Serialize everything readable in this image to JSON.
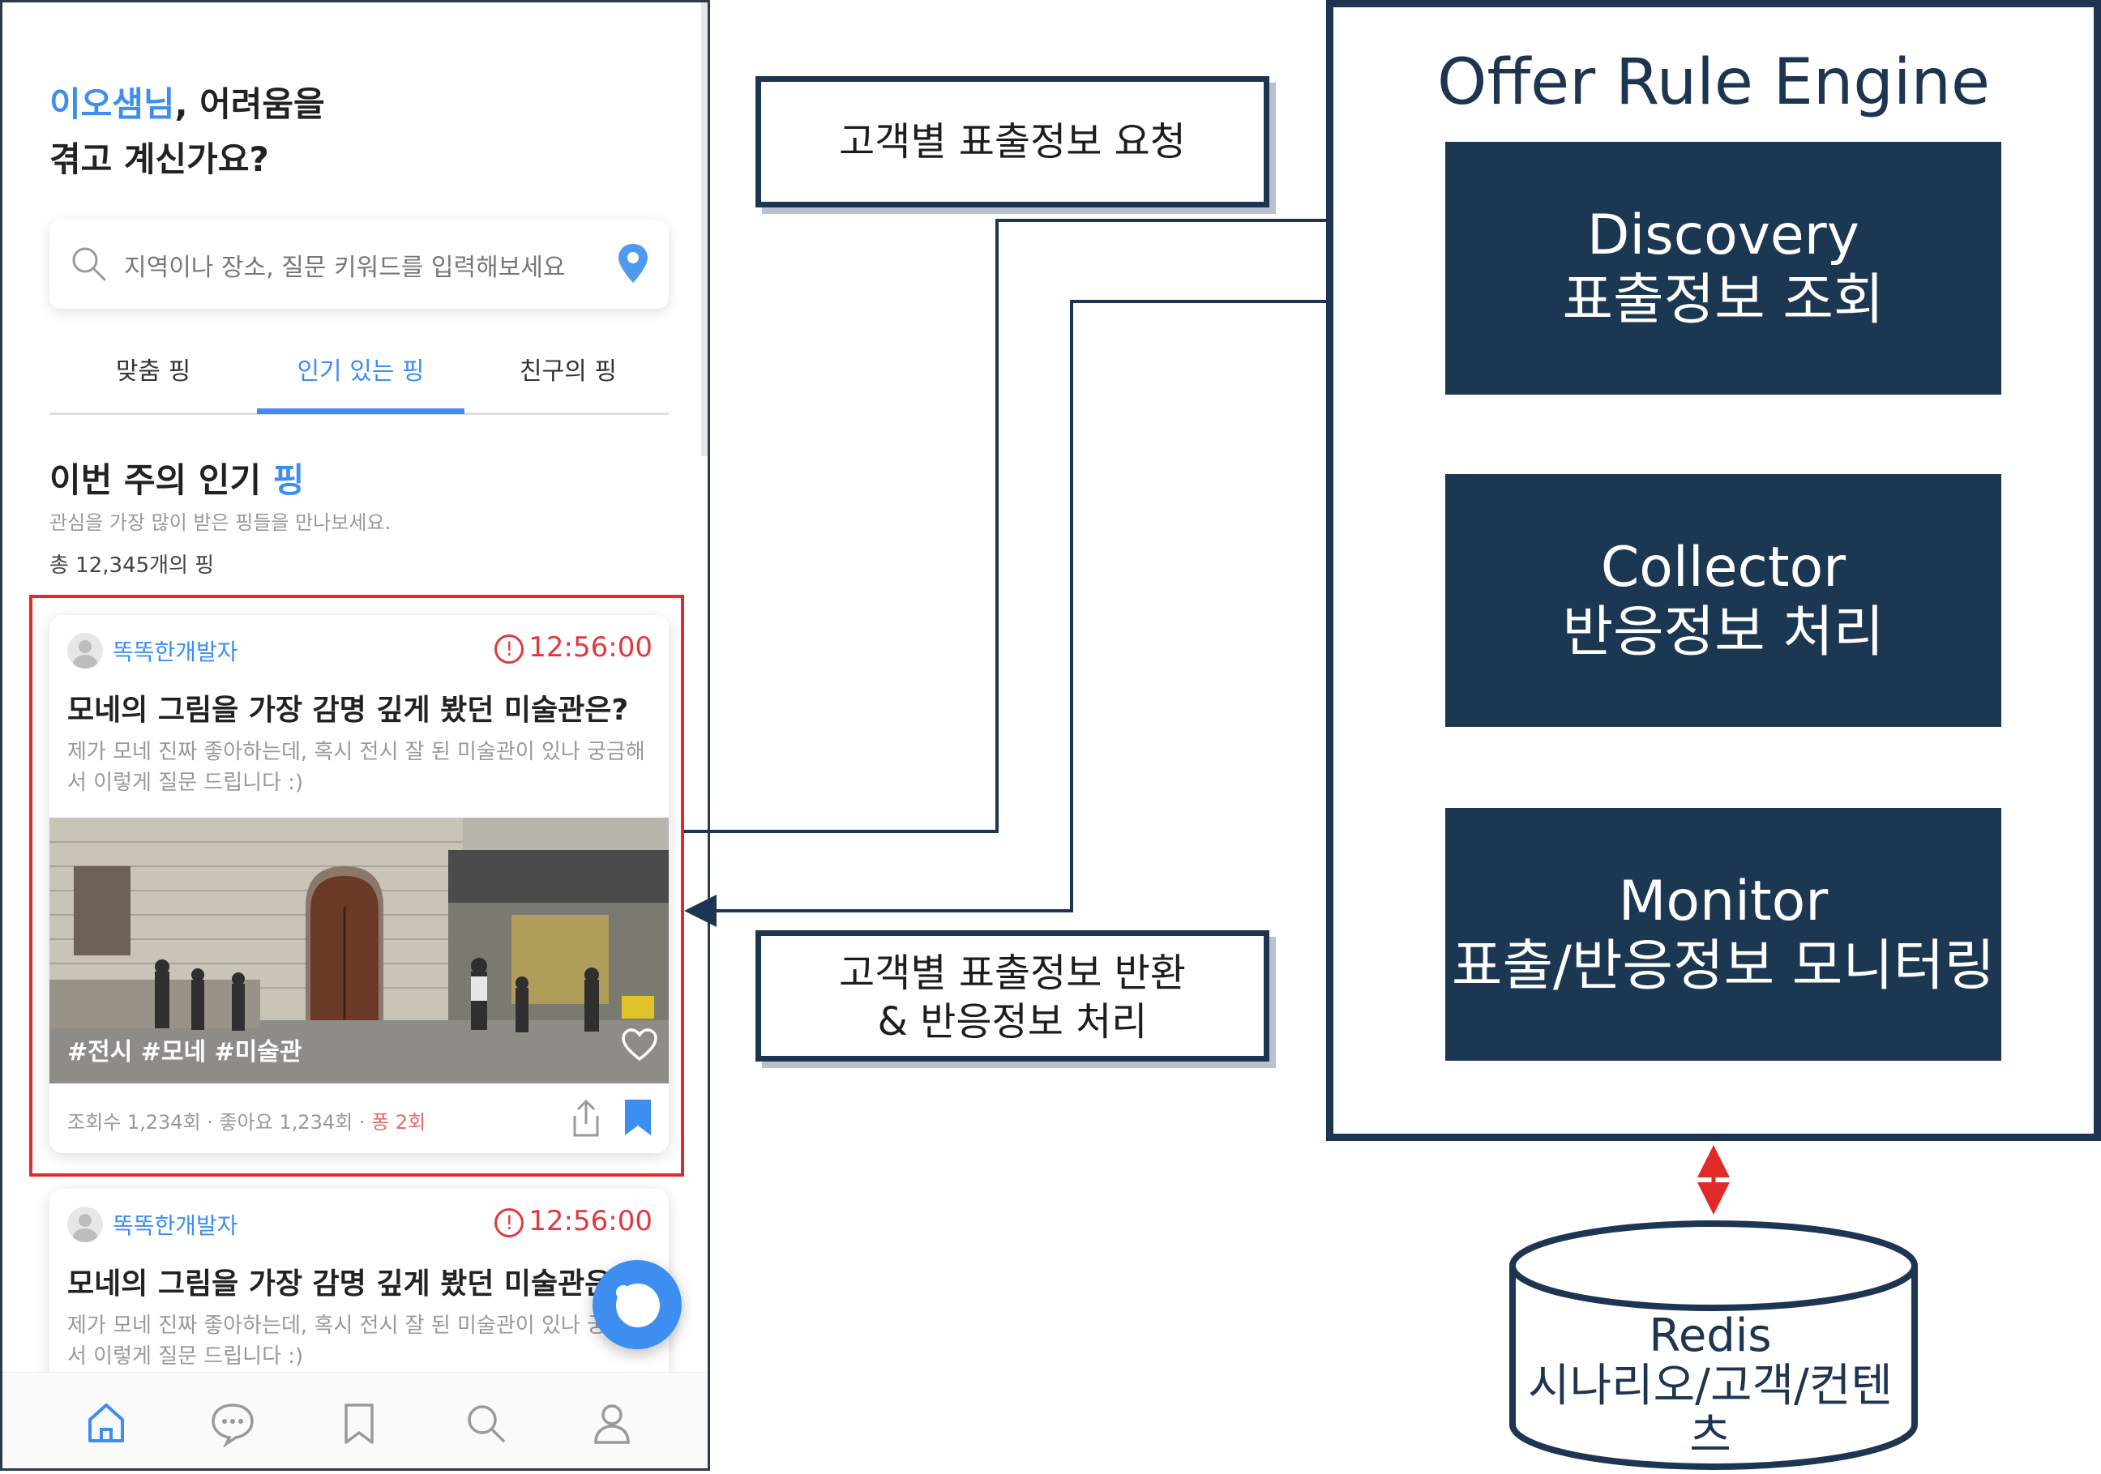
{
  "phone": {
    "greeting_name": "이오샘님",
    "greeting_rest": ", 어려움을",
    "greeting_line2": "겪고 계신가요?",
    "search_placeholder": "지역이나 장소, 질문 키워드를 입력해보세요",
    "tabs": [
      {
        "label": "맞춤 핑",
        "active": false
      },
      {
        "label": "인기 있는 핑",
        "active": true
      },
      {
        "label": "친구의 핑",
        "active": false
      }
    ],
    "section_title": "이번 주의 인기",
    "section_title_highlight": "핑",
    "section_subtitle": "관심을 가장 많이 받은 핑들을 만나보세요.",
    "section_count": "총 12,345개의 핑",
    "cards": [
      {
        "author": "똑똑한개발자",
        "timer": "12:56:00",
        "title": "모네의 그림을 가장 감명 깊게 봤던 미술관은?",
        "body": "제가 모네 진짜 좋아하는데, 혹시 전시 잘 된 미술관이 있나 궁금해서 이렇게 질문 드립니다 :)",
        "tags": "#전시 #모네 #미술관",
        "meta_prefix": "조회수 1,234회 · 좋아요 1,234회 · ",
        "meta_pong": "퐁 2회"
      },
      {
        "author": "똑똑한개발자",
        "timer": "12:56:00",
        "title": "모네의 그림을 가장 감명 깊게 봤던 미술관은?",
        "body": "제가 모네 진짜 좋아하는데, 혹시 전시 잘 된 미술관이 있나 궁금해서 이렇게 질문 드립니다 :)"
      }
    ],
    "nav_icons": [
      "home-icon",
      "chat-icon",
      "bookmark-icon",
      "search-icon",
      "profile-icon"
    ],
    "accent_color": "#3d8ef0",
    "timer_color": "#e0393e"
  },
  "diagram": {
    "request_label": "고객별 표출정보 요청",
    "response_label_line1": "고객별 표출정보 반환",
    "response_label_line2": "& 반응정보 처리",
    "engine_title": "Offer Rule Engine",
    "modules": [
      {
        "name": "Discovery",
        "desc": "표출정보 조회"
      },
      {
        "name": "Collector",
        "desc": "반응정보 처리"
      },
      {
        "name": "Monitor",
        "desc": "표출/반응정보 모니터링"
      }
    ],
    "store_name": "Redis",
    "store_desc": "시나리오/고객/컨텐츠",
    "box_color": "#1b3752",
    "arrow_color": "#e02a2a",
    "highlight_color": "#e02a2a"
  }
}
